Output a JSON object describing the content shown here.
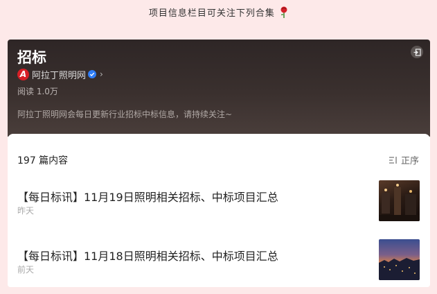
{
  "top_note": "项目信息栏目可关注下列合集",
  "hero": {
    "title": "招标",
    "account_name": "阿拉丁照明网",
    "logo_letter": "A",
    "reads": "阅读 1.0万",
    "description": "阿拉丁照明网会每日更新行业招标中标信息，请持续关注~"
  },
  "list": {
    "count": "197 篇内容",
    "sort_label": "正序",
    "articles": [
      {
        "title": "【每日标讯】11月19日照明相关招标、中标项目汇总",
        "date": "昨天"
      },
      {
        "title": "【每日标讯】11月18日照明相关招标、中标项目汇总",
        "date": "前天"
      }
    ]
  },
  "colors": {
    "brand_red": "#d61f26",
    "verified_blue": "#2f7df6"
  }
}
